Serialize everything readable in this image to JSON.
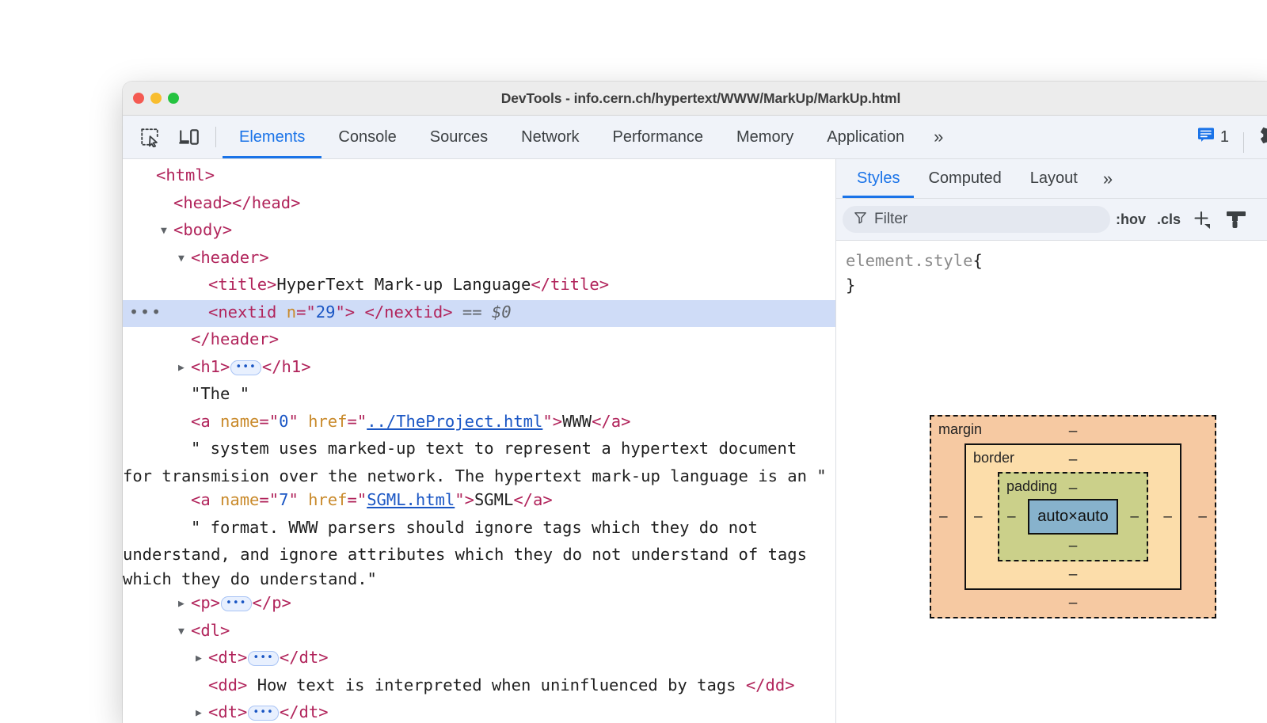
{
  "window": {
    "title": "DevTools - info.cern.ch/hypertext/WWW/MarkUp/MarkUp.html",
    "traffic_lights": [
      "close",
      "minimize",
      "zoom"
    ]
  },
  "toolbar": {
    "icons": [
      {
        "name": "inspect-element-icon",
        "label": "Inspect element"
      },
      {
        "name": "device-toolbar-icon",
        "label": "Toggle device toolbar"
      }
    ],
    "tabs": [
      {
        "label": "Elements",
        "active": true
      },
      {
        "label": "Console",
        "active": false
      },
      {
        "label": "Sources",
        "active": false
      },
      {
        "label": "Network",
        "active": false
      },
      {
        "label": "Performance",
        "active": false
      },
      {
        "label": "Memory",
        "active": false
      },
      {
        "label": "Application",
        "active": false
      }
    ],
    "more_tabs_label": "»",
    "message_count": "1",
    "settings_label": "Settings"
  },
  "dom_tree": {
    "rows": [
      {
        "id": "html-open",
        "indent": 0,
        "twisty": "none",
        "selected": false,
        "parts": [
          {
            "t": "tag",
            "v": "<html>"
          }
        ]
      },
      {
        "id": "head",
        "indent": 1,
        "twisty": "none",
        "selected": false,
        "parts": [
          {
            "t": "tag",
            "v": "<head></head>"
          }
        ]
      },
      {
        "id": "body-open",
        "indent": 1,
        "twisty": "expanded",
        "selected": false,
        "parts": [
          {
            "t": "tag",
            "v": "<body>"
          }
        ]
      },
      {
        "id": "header-open",
        "indent": 2,
        "twisty": "expanded",
        "selected": false,
        "parts": [
          {
            "t": "tag",
            "v": "<header>"
          }
        ]
      },
      {
        "id": "title",
        "indent": 3,
        "twisty": "none",
        "selected": false,
        "parts": [
          {
            "t": "tag",
            "v": "<title>"
          },
          {
            "t": "txt",
            "v": "HyperText Mark-up Language"
          },
          {
            "t": "tag",
            "v": "</title>"
          }
        ]
      },
      {
        "id": "nextid",
        "indent": 3,
        "twisty": "none",
        "selected": true,
        "menu": "•••",
        "parts": [
          {
            "t": "tag",
            "v": "<nextid "
          },
          {
            "t": "attr",
            "v": "n"
          },
          {
            "t": "tag",
            "v": "=\""
          },
          {
            "t": "val",
            "v": "29"
          },
          {
            "t": "tag",
            "v": "\"> </nextid>"
          },
          {
            "t": "eq",
            "v": " == $0"
          }
        ]
      },
      {
        "id": "header-close",
        "indent": 2,
        "twisty": "none",
        "selected": false,
        "parts": [
          {
            "t": "tag",
            "v": "</header>"
          }
        ]
      },
      {
        "id": "h1",
        "indent": 2,
        "twisty": "collapsed",
        "selected": false,
        "parts": [
          {
            "t": "tag",
            "v": "<h1>"
          },
          {
            "t": "ellipsis",
            "v": "•••"
          },
          {
            "t": "tag",
            "v": "</h1>"
          }
        ]
      },
      {
        "id": "text-the",
        "indent": 2,
        "twisty": "none",
        "selected": false,
        "parts": [
          {
            "t": "txt",
            "v": "\"The \""
          }
        ]
      },
      {
        "id": "a-www",
        "indent": 2,
        "twisty": "none",
        "selected": false,
        "parts": [
          {
            "t": "tag",
            "v": "<a "
          },
          {
            "t": "attr",
            "v": "name"
          },
          {
            "t": "tag",
            "v": "=\""
          },
          {
            "t": "val",
            "v": "0"
          },
          {
            "t": "tag",
            "v": "\" "
          },
          {
            "t": "attr",
            "v": "href"
          },
          {
            "t": "tag",
            "v": "=\""
          },
          {
            "t": "lnk",
            "v": "../TheProject.html"
          },
          {
            "t": "tag",
            "v": "\">"
          },
          {
            "t": "txt",
            "v": "WWW"
          },
          {
            "t": "tag",
            "v": "</a>"
          }
        ]
      },
      {
        "id": "text-system",
        "indent": 2,
        "twisty": "none",
        "wrap": true,
        "selected": false,
        "parts": [
          {
            "t": "txt",
            "v": "\" system uses marked-up text to represent a hypertext document for transmision over the network. The hypertext mark-up language is an \""
          }
        ]
      },
      {
        "id": "a-sgml",
        "indent": 2,
        "twisty": "none",
        "selected": false,
        "parts": [
          {
            "t": "tag",
            "v": "<a "
          },
          {
            "t": "attr",
            "v": "name"
          },
          {
            "t": "tag",
            "v": "=\""
          },
          {
            "t": "val",
            "v": "7"
          },
          {
            "t": "tag",
            "v": "\" "
          },
          {
            "t": "attr",
            "v": "href"
          },
          {
            "t": "tag",
            "v": "=\""
          },
          {
            "t": "lnk",
            "v": "SGML.html"
          },
          {
            "t": "tag",
            "v": "\">"
          },
          {
            "t": "txt",
            "v": "SGML"
          },
          {
            "t": "tag",
            "v": "</a>"
          }
        ]
      },
      {
        "id": "text-format",
        "indent": 2,
        "twisty": "none",
        "wrap": true,
        "selected": false,
        "parts": [
          {
            "t": "txt",
            "v": "\" format. WWW parsers should ignore tags which they do not understand, and ignore attributes which they do not understand of tags which they do understand.\""
          }
        ]
      },
      {
        "id": "p",
        "indent": 2,
        "twisty": "collapsed",
        "selected": false,
        "parts": [
          {
            "t": "tag",
            "v": "<p>"
          },
          {
            "t": "ellipsis",
            "v": "•••"
          },
          {
            "t": "tag",
            "v": "</p>"
          }
        ]
      },
      {
        "id": "dl-open",
        "indent": 2,
        "twisty": "expanded",
        "selected": false,
        "parts": [
          {
            "t": "tag",
            "v": "<dl>"
          }
        ]
      },
      {
        "id": "dt-1",
        "indent": 3,
        "twisty": "collapsed",
        "selected": false,
        "parts": [
          {
            "t": "tag",
            "v": "<dt>"
          },
          {
            "t": "ellipsis",
            "v": "•••"
          },
          {
            "t": "tag",
            "v": "</dt>"
          }
        ]
      },
      {
        "id": "dd-1",
        "indent": 3,
        "twisty": "none",
        "selected": false,
        "parts": [
          {
            "t": "tag",
            "v": "<dd>"
          },
          {
            "t": "txt",
            "v": " How text is interpreted when uninfluenced by tags "
          },
          {
            "t": "tag",
            "v": "</dd>"
          }
        ]
      },
      {
        "id": "dt-2",
        "indent": 3,
        "twisty": "collapsed",
        "selected": false,
        "parts": [
          {
            "t": "tag",
            "v": "<dt>"
          },
          {
            "t": "ellipsis",
            "v": "•••"
          },
          {
            "t": "tag",
            "v": "</dt>"
          }
        ]
      }
    ]
  },
  "styles_sidebar": {
    "tabs": [
      {
        "label": "Styles",
        "active": true
      },
      {
        "label": "Computed",
        "active": false
      },
      {
        "label": "Layout",
        "active": false
      }
    ],
    "more_tabs_label": "»",
    "filter_placeholder": "Filter",
    "filter_value": "",
    "actions": [
      {
        "name": "toggle-element-state-button",
        "label": ":hov"
      },
      {
        "name": "element-classes-button",
        "label": ".cls"
      }
    ],
    "new_style_rule_label": "+",
    "rules": [
      {
        "selector": "element.style",
        "open_brace": "{",
        "close_brace": "}",
        "declarations": []
      }
    ]
  },
  "box_model": {
    "margin": {
      "label": "margin",
      "top": "–",
      "right": "–",
      "bottom": "–",
      "left": "–"
    },
    "border": {
      "label": "border",
      "top": "–",
      "right": "–",
      "bottom": "–",
      "left": "–"
    },
    "padding": {
      "label": "padding",
      "top": "–",
      "right": "–",
      "bottom": "–",
      "left": "–"
    },
    "content": {
      "size": "auto×auto"
    },
    "colors": {
      "margin": "#f6c9a2",
      "border": "#fcddaa",
      "padding": "#cbd08a",
      "content": "#87b2cc"
    }
  },
  "colors": {
    "accent": "#1a73e8",
    "toolbar_bg": "#f0f3f9",
    "titlebar_bg": "#ececec",
    "selected_row": "#cfdcf7",
    "tag": "#b1245b",
    "attr_name": "#c98a2b",
    "attr_value": "#1a56c4"
  }
}
